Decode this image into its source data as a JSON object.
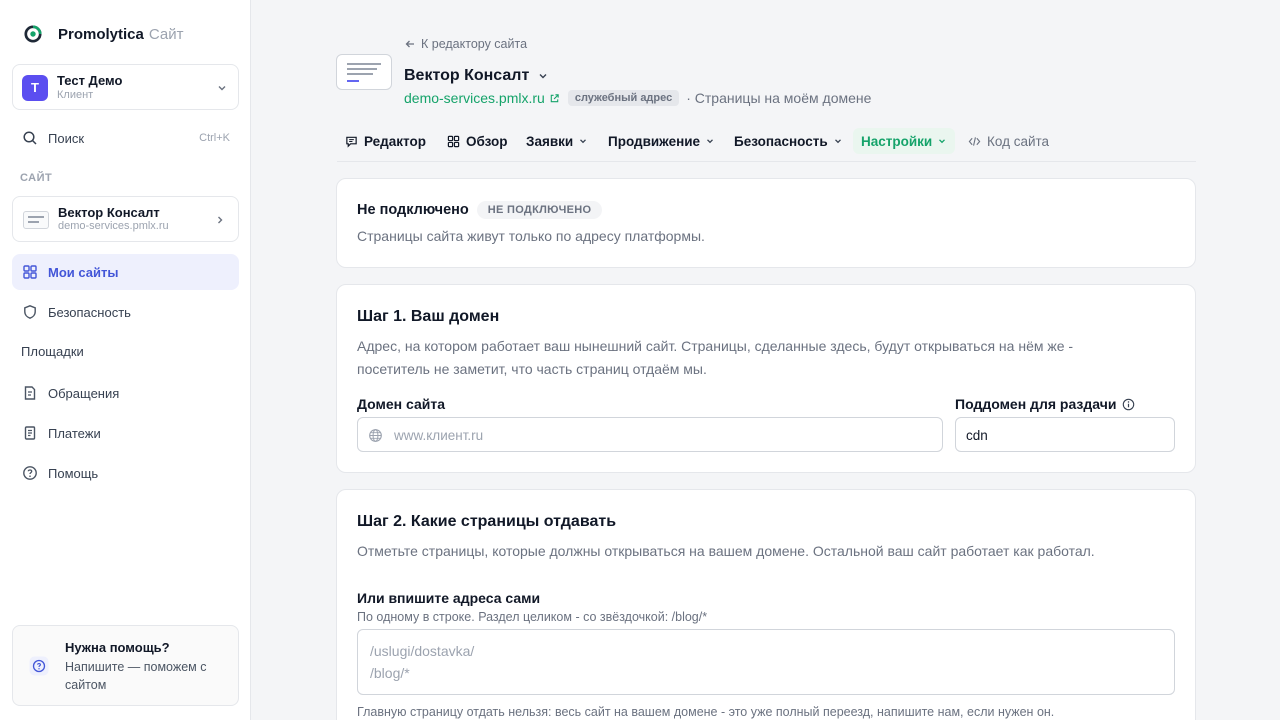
{
  "brand": {
    "name": "Promolytica",
    "suffix": "Сайт"
  },
  "account": {
    "initial": "Т",
    "name": "Тест Демо",
    "role": "Клиент"
  },
  "search": {
    "label": "Поиск",
    "shortcut": "Ctrl+K"
  },
  "sidebar": {
    "section_label": "САЙТ",
    "site": {
      "name": "Вектор Консалт",
      "url": "demo-services.pmlx.ru"
    },
    "items": [
      {
        "label": "Мои сайты",
        "icon": "grid-icon",
        "active": true
      },
      {
        "label": "Безопасность",
        "icon": "shield-icon"
      },
      {
        "label": "Площадки",
        "icon": ""
      },
      {
        "label": "Обращения",
        "icon": "document-icon"
      },
      {
        "label": "Платежи",
        "icon": "receipt-icon"
      },
      {
        "label": "Помощь",
        "icon": "help-circle-icon"
      }
    ],
    "help": {
      "title": "Нужна помощь?",
      "text": "Напишите — поможем с сайтом"
    }
  },
  "header": {
    "back_label": "К редактору сайта",
    "title": "Вектор Консалт",
    "domain": "demo-services.pmlx.ru",
    "service_badge": "служебный адрес",
    "extra": "· Страницы на моём домене"
  },
  "tabs": [
    {
      "label": "Редактор",
      "icon": "chat-icon"
    },
    {
      "label": "Обзор",
      "icon": "grid-icon"
    },
    {
      "label": "Заявки",
      "chevron": true
    },
    {
      "label": "Продвижение",
      "chevron": true
    },
    {
      "label": "Безопасность",
      "chevron": true
    },
    {
      "label": "Настройки",
      "chevron": true,
      "active": true
    },
    {
      "label": "Код сайта",
      "icon": "code-icon"
    }
  ],
  "status": {
    "title": "Не подключено",
    "badge": "НЕ ПОДКЛЮЧЕНО",
    "description": "Страницы сайта живут только по адресу платформы."
  },
  "step1": {
    "title": "Шаг 1. Ваш домен",
    "description": "Адрес, на котором работает ваш нынешний сайт. Страницы, сделанные здесь, будут открываться на нём же - посетитель не заметит, что часть страниц отдаём мы.",
    "domain_label": "Домен сайта",
    "domain_placeholder": "www.клиент.ru",
    "subdomain_label": "Поддомен для раздачи",
    "subdomain_value": "cdn"
  },
  "step2": {
    "title": "Шаг 2. Какие страницы отдавать",
    "description": "Отметьте страницы, которые должны открываться на вашем домене. Остальной ваш сайт работает как работал.",
    "manual_label": "Или впишите адреса сами",
    "manual_hint": "По одному в строке. Раздел целиком - со звёздочкой: /blog/*",
    "placeholder_lines": [
      "/uslugi/dostavka/",
      "/blog/*"
    ],
    "footnote": "Главную страницу отдать нельзя: весь сайт на вашем домене - это уже полный переезд, напишите нам, если нужен он."
  },
  "colors": {
    "accent_green": "#15a36a",
    "accent_blue": "#4356d8",
    "avatar": "#5b4ef0"
  }
}
